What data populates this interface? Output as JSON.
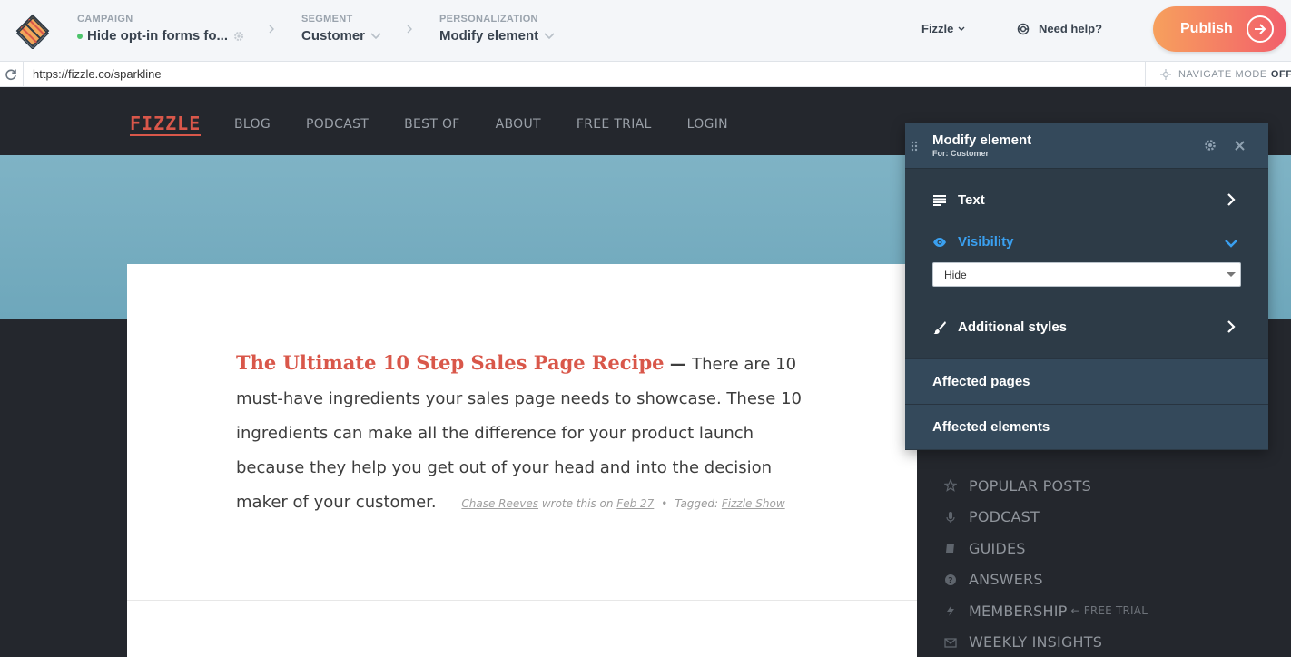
{
  "topbar": {
    "campaign": {
      "label": "CAMPAIGN",
      "value": "Hide opt-in forms fo..."
    },
    "segment": {
      "label": "SEGMENT",
      "value": "Customer"
    },
    "personalization": {
      "label": "PERSONALIZATION",
      "value": "Modify element"
    },
    "account": "Fizzle",
    "help": "Need help?",
    "publish": "Publish"
  },
  "urlbar": {
    "url": "https://fizzle.co/sparkline",
    "navigate_label": "NAVIGATE MODE",
    "navigate_state": "OFF"
  },
  "site": {
    "logo": "FIZZLE",
    "menu": [
      "BLOG",
      "PODCAST",
      "BEST OF",
      "ABOUT",
      "FREE TRIAL",
      "LOGIN"
    ],
    "post": {
      "title": "The Ultimate 10 Step Sales Page Recipe",
      "dash": " — ",
      "body": "There are 10 must-have ingredients your sales page needs to showcase. These 10 ingredients can make all the difference for your product launch because they help you get out of your head and into the decision maker of your customer.",
      "author": "Chase Reeves",
      "wrote": " wrote this on ",
      "date": "Feb 27",
      "bullet": "•",
      "tagged": "Tagged: ",
      "tag": "Fizzle Show"
    },
    "sidebar": [
      {
        "icon": "star-icon",
        "label": "POPULAR POSTS"
      },
      {
        "icon": "microphone-icon",
        "label": "PODCAST"
      },
      {
        "icon": "book-icon",
        "label": "GUIDES"
      },
      {
        "icon": "question-icon",
        "label": "ANSWERS"
      },
      {
        "icon": "bolt-icon",
        "label": "MEMBERSHIP",
        "sub": "← FREE TRIAL"
      },
      {
        "icon": "envelope-icon",
        "label": "WEEKLY INSIGHTS"
      }
    ]
  },
  "panel": {
    "title": "Modify element",
    "subtitle": "For: Customer",
    "text_label": "Text",
    "visibility_label": "Visibility",
    "visibility_value": "Hide",
    "styles_label": "Additional styles",
    "affected_pages": "Affected pages",
    "affected_elements": "Affected elements",
    "accent": "#3aa0f0"
  }
}
